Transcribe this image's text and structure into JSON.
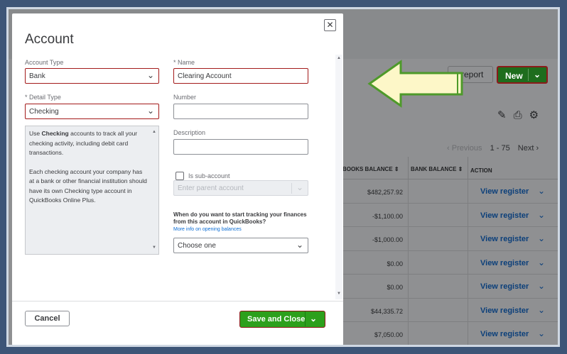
{
  "background": {
    "run_report_label": "n report",
    "new_label": "New",
    "pager": {
      "previous": "Previous",
      "range": "1 - 75",
      "next": "Next"
    },
    "columns": [
      "BOOKS BALANCE",
      "BANK BALANCE",
      "ACTION"
    ],
    "rows": [
      {
        "balance": "$482,257.92",
        "action": "View register"
      },
      {
        "balance": "-$1,100.00",
        "action": "View register"
      },
      {
        "balance": "-$1,000.00",
        "action": "View register"
      },
      {
        "balance": "$0.00",
        "action": "View register"
      },
      {
        "balance": "$0.00",
        "action": "View register"
      },
      {
        "balance": "$44,335.72",
        "action": "View register"
      },
      {
        "balance": "$7,050.00",
        "action": "View register"
      }
    ]
  },
  "modal": {
    "title": "Account",
    "close_glyph": "✕",
    "account_type": {
      "label": "Account Type",
      "value": "Bank"
    },
    "name": {
      "label": "* Name",
      "value": "Clearing Account"
    },
    "detail_type": {
      "label": "* Detail Type",
      "value": "Checking"
    },
    "number": {
      "label": "Number",
      "value": ""
    },
    "description": {
      "label": "Description",
      "value": ""
    },
    "detail_desc": {
      "p1_pre": "Use ",
      "p1_bold": "Checking",
      "p1_post": " accounts to track all your checking activity, including debit card transactions.",
      "p2": "Each checking account your company has at a bank or other financial institution should have its own Checking type account in QuickBooks Online Plus."
    },
    "sub_account": {
      "label": "Is sub-account",
      "placeholder": "Enter parent account"
    },
    "opening": {
      "question": "When do you want to start tracking your finances from this account in QuickBooks?",
      "link": "More info on opening balances",
      "placeholder": "Choose one"
    },
    "cancel_label": "Cancel",
    "save_label": "Save and Close"
  },
  "colors": {
    "primary_green": "#2ca01c",
    "highlight_red": "#a31a1a",
    "arrow_fill": "#fdf7c8",
    "arrow_stroke": "#4e9a2a"
  }
}
